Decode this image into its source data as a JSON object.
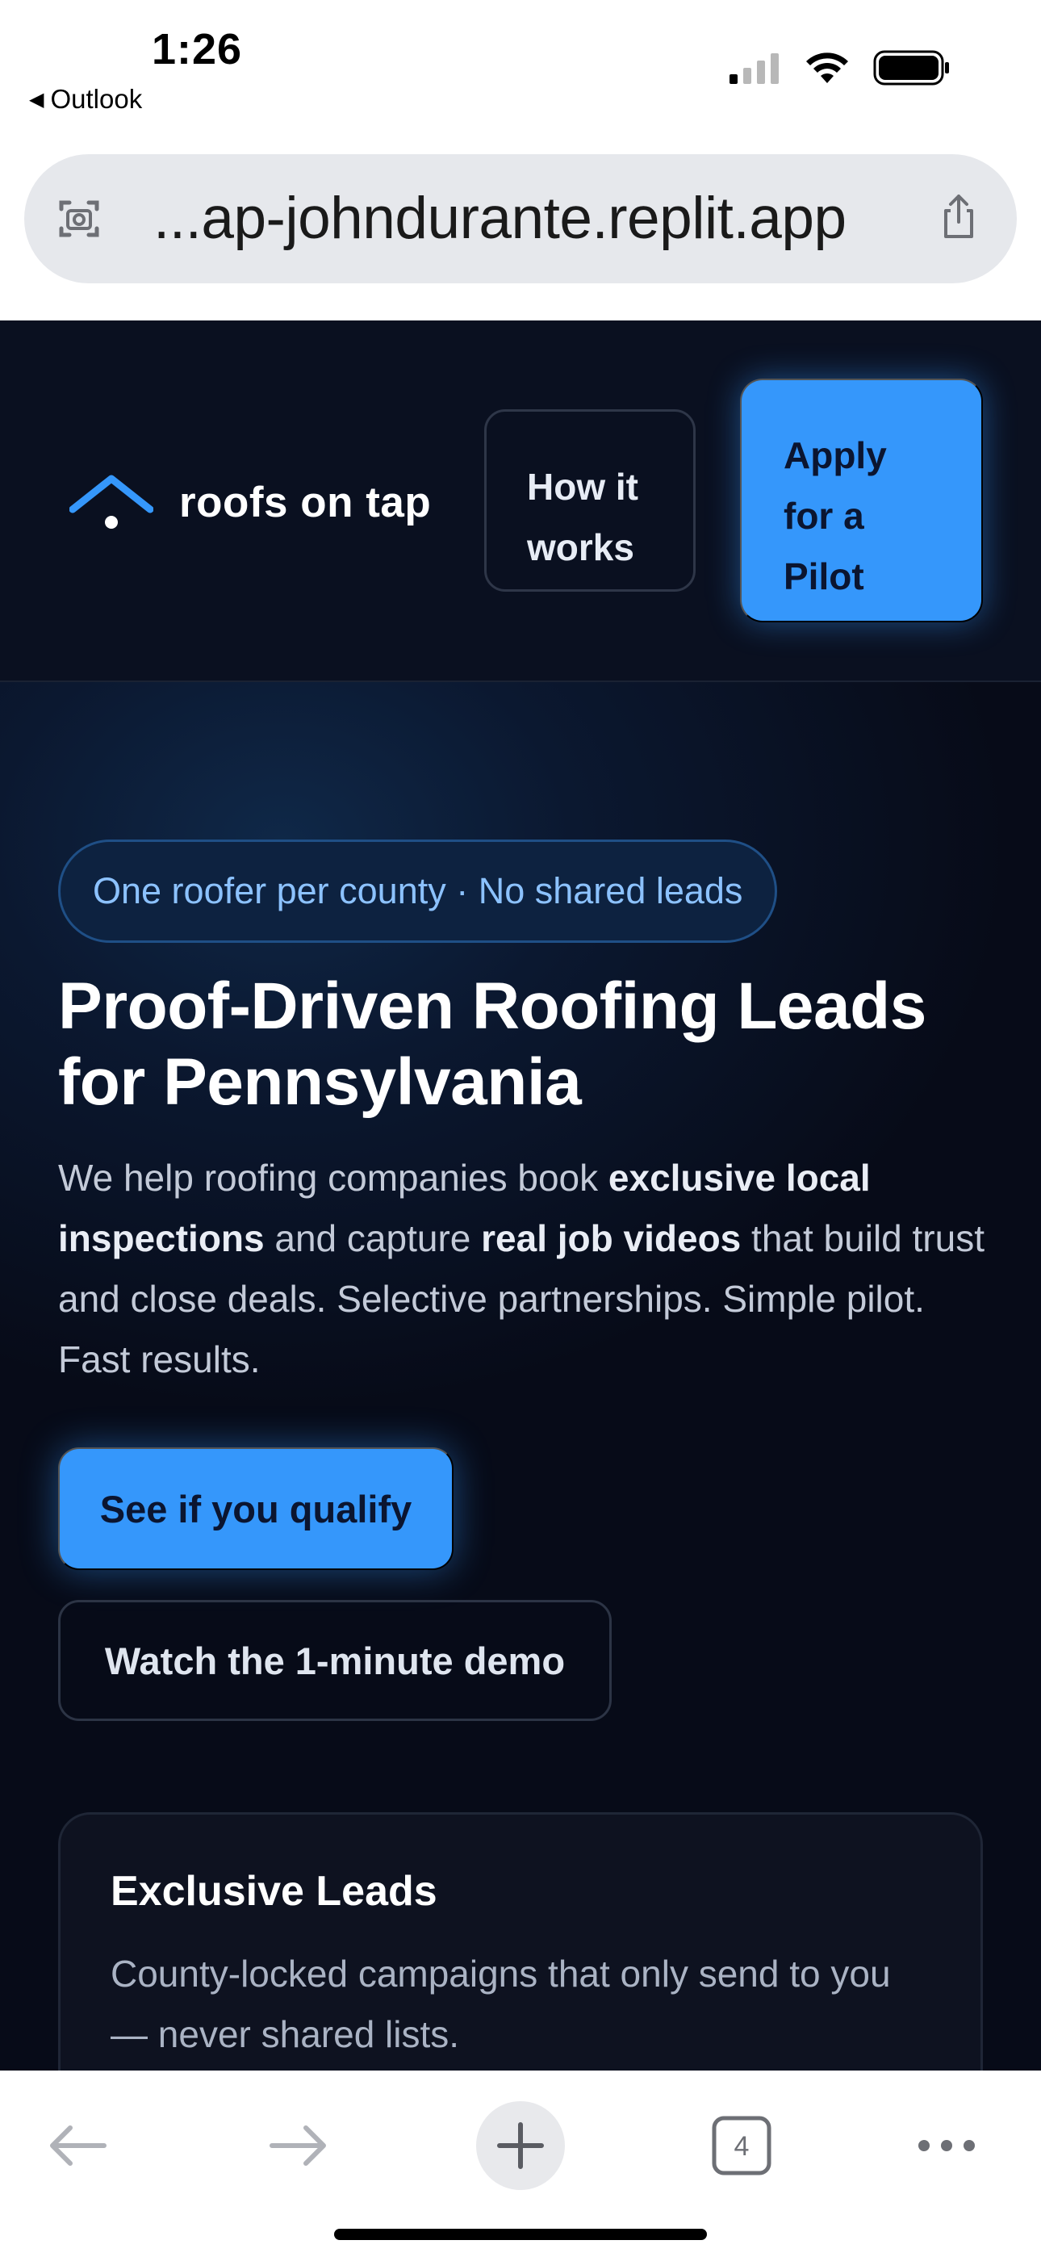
{
  "status_bar": {
    "time": "1:26",
    "back_app": "Outlook",
    "signal_icon": "cellular-signal-icon",
    "wifi_icon": "wifi-icon",
    "battery_icon": "battery-icon"
  },
  "browser": {
    "url_display": "...ap-johndurante.replit.app",
    "left_icon": "page-tools-icon",
    "share_icon": "share-icon",
    "toolbar": {
      "back_icon": "back-arrow-icon",
      "forward_icon": "forward-arrow-icon",
      "new_tab_icon": "plus-icon",
      "tab_count": "4",
      "menu_icon": "more-dots-icon"
    }
  },
  "site": {
    "brand": "roofs on tap",
    "brand_icon": "roof-logo-icon",
    "nav": {
      "how_it_works": "How it\nworks",
      "apply": "Apply\nfor a\nPilot"
    },
    "colors": {
      "accent": "#3597fb",
      "background": "#070b18",
      "badge_text": "#8cc2ff"
    }
  },
  "hero": {
    "badge": "One roofer per county · No shared leads",
    "title": "Proof-Driven Roofing Leads for Pennsylvania",
    "desc_parts": {
      "p1": "We help roofing companies book ",
      "b1": "exclusive local inspections",
      "p2": " and capture ",
      "b2": "real job videos",
      "p3": " that build trust and close deals. Selective partnerships. Simple pilot. Fast results."
    },
    "cta_primary": "See if you qualify",
    "cta_secondary": "Watch the 1-minute demo"
  },
  "features": [
    {
      "title": "Exclusive Leads",
      "text": "County-locked campaigns that only send to you — never shared lists."
    }
  ]
}
